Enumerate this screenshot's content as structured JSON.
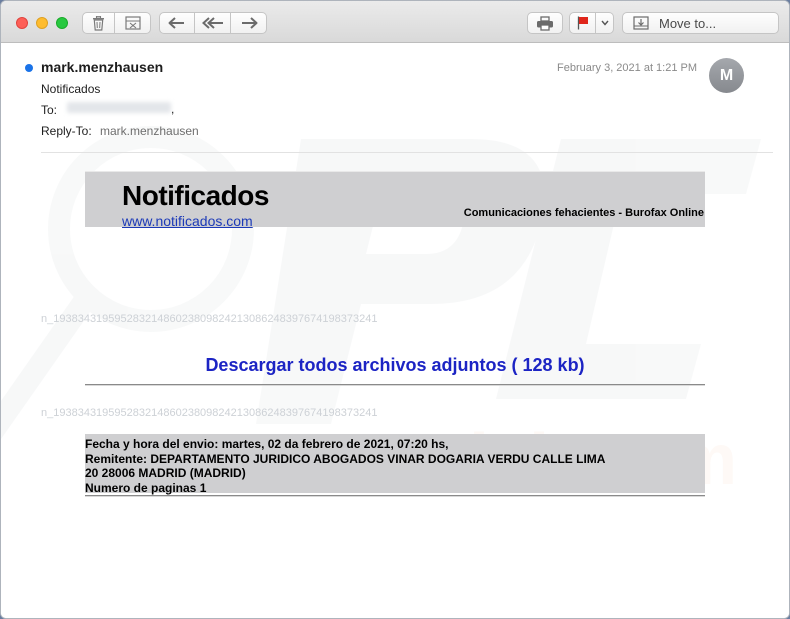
{
  "toolbar": {
    "buttons": [
      "delete",
      "junk",
      "reply",
      "reply-all",
      "forward",
      "print",
      "flag",
      "flag-menu"
    ],
    "move_to_label": "Move to...",
    "flag_color": "#e0261b"
  },
  "message": {
    "sender": "mark.menzhausen",
    "subject": "Notificados",
    "to_label": "To:",
    "to_suffix": ",",
    "reply_to_label": "Reply-To:",
    "reply_to_value": "mark.menzhausen",
    "date": "February 3, 2021 at 1:21 PM",
    "avatar_initial": "M",
    "unread_color": "#1a73e8"
  },
  "body": {
    "banner_title": "Notificados",
    "banner_link": "www.notificados.com",
    "banner_subtitle": "Comunicaciones fehacientes - Burofax Online",
    "tracking_line_1": "n_19383431959528321486023809824213086248397674198373241",
    "tracking_line_2": "n_19383431959528321486023809824213086248397674198373241",
    "download_link": "Descargar todos archivos adjuntos ( 128 kb)",
    "details": [
      "Fecha y hora del envio: martes, 02 da febrero de 2021, 07:20 hs,",
      "Remitente: DEPARTAMENTO JURIDICO ABOGADOS VINAR DOGARIA VERDU CALLE LIMA",
      "20 28006 MADRID (MADRID)",
      "Numero de paginas 1"
    ]
  }
}
